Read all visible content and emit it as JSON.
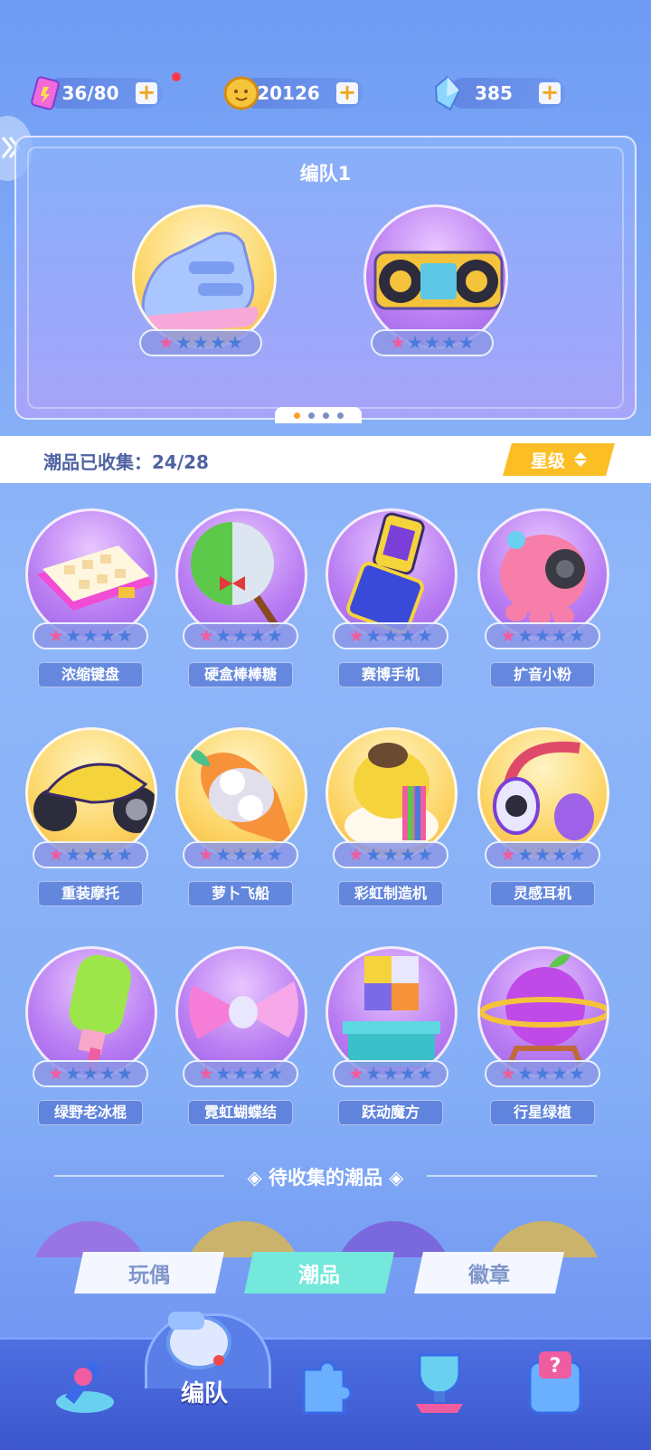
{
  "resources": {
    "energy": {
      "value": "36/80",
      "icon": "energy-card-icon"
    },
    "coins": {
      "value": "20126",
      "icon": "coin-icon"
    },
    "gems": {
      "value": "385",
      "icon": "crystal-icon"
    }
  },
  "team": {
    "title": "编队1",
    "slots": [
      {
        "icon": "sneaker-icon",
        "stars": 1
      },
      {
        "icon": "boombox-icon",
        "stars": 1
      }
    ],
    "page_dots": 4,
    "active_page": 1
  },
  "collection": {
    "progress_text": "潮品已收集：24/28",
    "sort_label": "星级"
  },
  "items": [
    {
      "name": "浓缩键盘",
      "icon": "keyboard-icon",
      "stars": 1
    },
    {
      "name": "硬盒棒棒糖",
      "icon": "lollipop-icon",
      "stars": 1
    },
    {
      "name": "赛博手机",
      "icon": "flip-phone-icon",
      "stars": 1
    },
    {
      "name": "扩音小粉",
      "icon": "speaker-octopus-icon",
      "stars": 1
    },
    {
      "name": "重装摩托",
      "icon": "motorcycle-icon",
      "stars": 1
    },
    {
      "name": "萝卜飞船",
      "icon": "carrot-ship-icon",
      "stars": 1
    },
    {
      "name": "彩虹制造机",
      "icon": "rainbow-machine-icon",
      "stars": 1
    },
    {
      "name": "灵感耳机",
      "icon": "headphones-icon",
      "stars": 1
    },
    {
      "name": "绿野老冰棍",
      "icon": "popsicle-icon",
      "stars": 1
    },
    {
      "name": "霓虹蝴蝶结",
      "icon": "bow-icon",
      "stars": 1
    },
    {
      "name": "跃动魔方",
      "icon": "cube-box-icon",
      "stars": 1
    },
    {
      "name": "行星绿植",
      "icon": "planet-plant-icon",
      "stars": 1
    }
  ],
  "pending": {
    "title": "◈ 待收集的潮品 ◈"
  },
  "tabs": [
    {
      "label": "玩偶",
      "active": false
    },
    {
      "label": "潮品",
      "active": true
    },
    {
      "label": "徽章",
      "active": false
    }
  ],
  "nav": {
    "active_label": "编队",
    "items": [
      "arrow-figure-icon",
      "whistle-icon",
      "puzzle-icon",
      "trophy-icon",
      "mystery-machine-icon"
    ]
  },
  "colors": {
    "accent_yellow": "#fbbf25",
    "tab_active": "#73e8db",
    "nav_bg": "#4d6fe0"
  }
}
